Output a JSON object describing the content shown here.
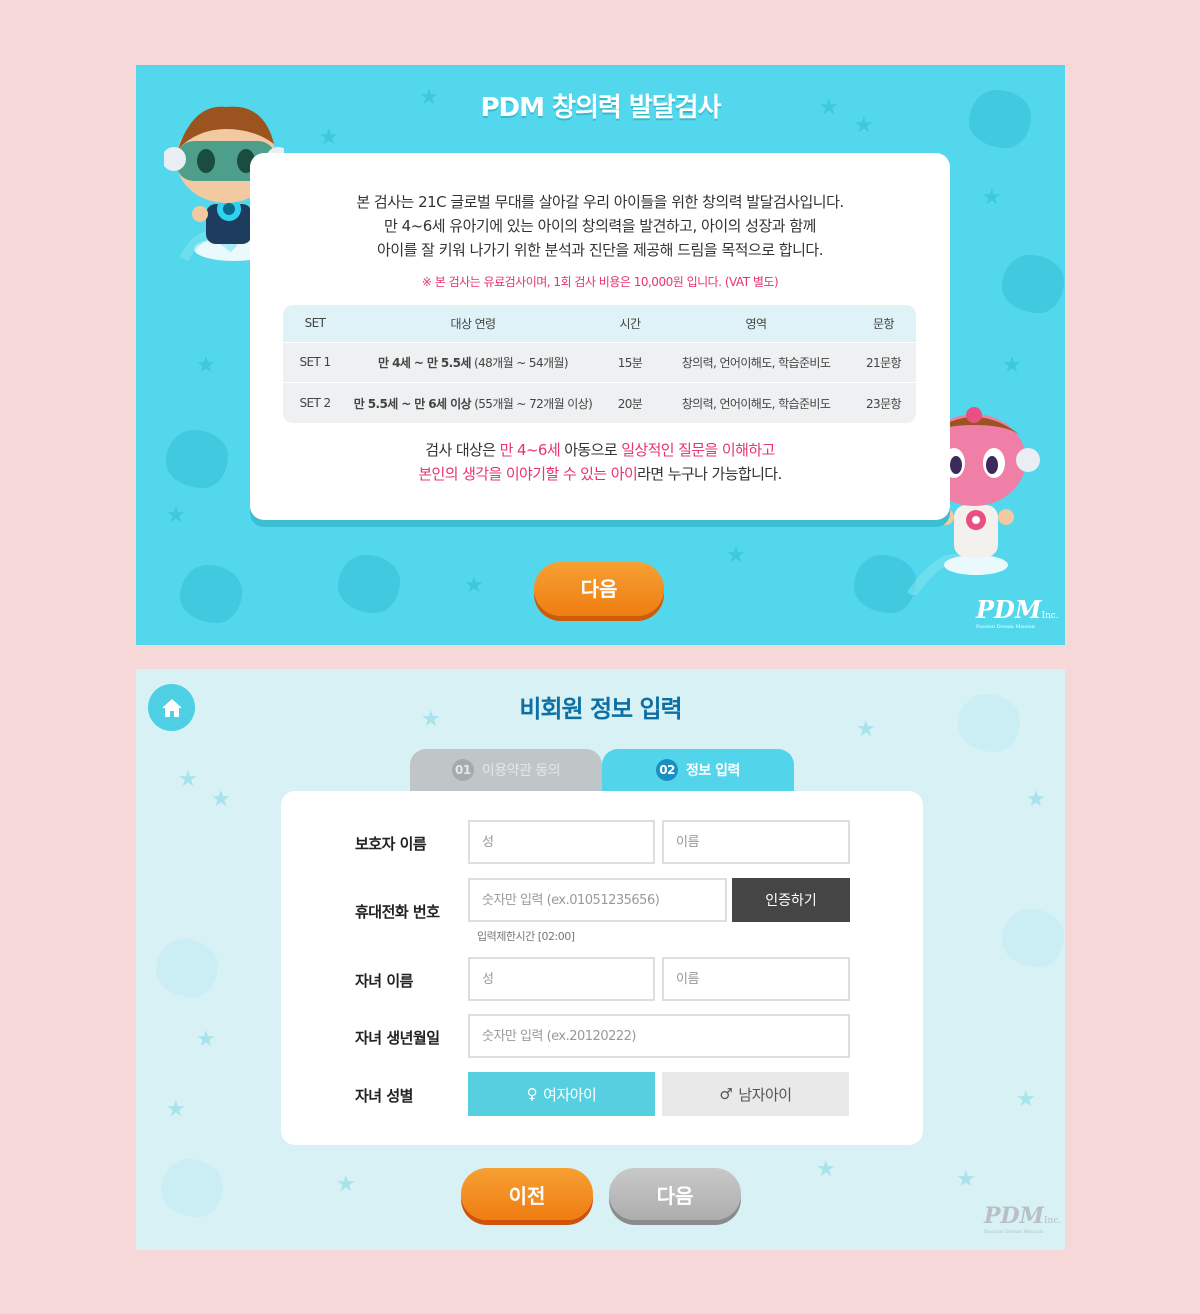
{
  "screen1": {
    "title": "PDM 창의력 발달검사",
    "intro_lines": [
      "본 검사는 21C 글로벌 무대를 살아갈 우리 아이들을 위한 창의력 발달검사입니다.",
      "만 4~6세 유아기에 있는 아이의 창의력을 발견하고, 아이의 성장과 함께",
      "아이를 잘 키워 나가기 위한 분석과 진단을 제공해 드림을 목적으로 합니다."
    ],
    "note": "※ 본 검사는 유료검사이며, 1회 검사 비용은 10,000원 입니다. (VAT 별도)",
    "table": {
      "headers": [
        "SET",
        "대상 연령",
        "시간",
        "영역",
        "문항"
      ],
      "rows": [
        {
          "set": "SET 1",
          "age_bold": "만 4세 ~ 만 5.5세",
          "age_sub": "(48개월 ~ 54개월)",
          "time": "15분",
          "area": "창의력, 언어이해도, 학습준비도",
          "count": "21문항"
        },
        {
          "set": "SET 2",
          "age_bold": "만 5.5세 ~ 만 6세 이상",
          "age_sub": "(55개월 ~ 72개월 이상)",
          "time": "20분",
          "area": "창의력, 언어이해도, 학습준비도",
          "count": "23문항"
        }
      ]
    },
    "target": {
      "p1": "검사 대상은 ",
      "h1": "만 4~6세",
      "p2": " 아동으로 ",
      "h2": "일상적인 질문을 이해하고",
      "h3": "본인의 생각을 이야기할 수 있는 아이",
      "p3": "라면 누구나 가능합니다."
    },
    "next_button": "다음",
    "logo": "PDM",
    "logo_suffix": "Inc.",
    "logo_sub": "Passion Dream Mission"
  },
  "screen2": {
    "title": "비회원 정보 입력",
    "tabs": [
      {
        "num": "01",
        "label": "이용약관 동의"
      },
      {
        "num": "02",
        "label": "정보 입력"
      }
    ],
    "form": {
      "guardian_label": "보호자 이름",
      "last_name_placeholder": "성",
      "first_name_placeholder": "이름",
      "phone_label": "휴대전화 번호",
      "phone_placeholder": "숫자만 입력 (ex.01051235656)",
      "verify_button": "인증하기",
      "timer": "입력제한시간 [02:00]",
      "child_name_label": "자녀 이름",
      "birth_label": "자녀 생년월일",
      "birth_placeholder": "숫자만 입력 (ex.20120222)",
      "gender_label": "자녀 성별",
      "girl": "여자아이",
      "boy": "남자아이"
    },
    "prev_button": "이전",
    "next_button": "다음",
    "logo": "PDM",
    "logo_suffix": "Inc.",
    "logo_sub": "Passion Dream Mission"
  },
  "colors": {
    "page_bg": "#f6d8d8",
    "panel1_bg": "#52d7ec",
    "panel2_bg": "#d7f1f5",
    "accent_orange": "#ef7d12",
    "highlight_pink": "#e8336d",
    "title_blue": "#0d6fa3"
  },
  "icons": {
    "home": "home-icon",
    "female": "female-icon",
    "male": "male-icon",
    "star": "star-icon"
  }
}
